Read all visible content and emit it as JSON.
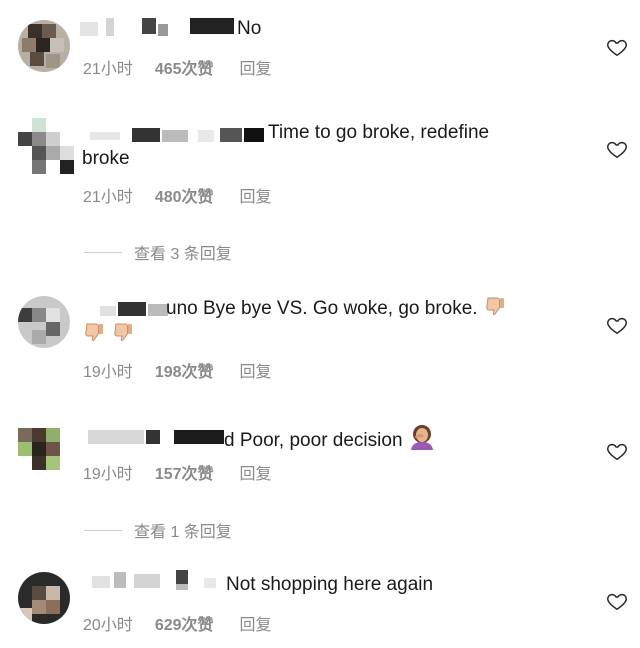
{
  "comments": [
    {
      "suffix": "No",
      "text": "",
      "time": "21小时",
      "likes": "465次赞",
      "reply": "回复"
    },
    {
      "suffix": "Time to go broke, redefine",
      "text_line2": "broke",
      "time": "21小时",
      "likes": "480次赞",
      "reply": "回复",
      "view_replies": "查看 3 条回复"
    },
    {
      "suffix": "uno Bye bye VS. Go woke, go broke.",
      "emoji_names": [
        "thumbs-down-icon",
        "thumbs-down-icon",
        "thumbs-down-icon"
      ],
      "time": "19小时",
      "likes": "198次赞",
      "reply": "回复"
    },
    {
      "suffix": "d Poor, poor decision",
      "emoji_names": [
        "face-palm-icon"
      ],
      "time": "19小时",
      "likes": "157次赞",
      "reply": "回复",
      "view_replies": "查看 1 条回复"
    },
    {
      "suffix": "Not shopping here again",
      "time": "20小时",
      "likes": "629次赞",
      "reply": "回复"
    }
  ],
  "icons": {
    "like": "heart-outline-icon"
  },
  "colors": {
    "meta": "#8a8a8a",
    "text": "#1a1a1a",
    "heart": "#262626"
  }
}
